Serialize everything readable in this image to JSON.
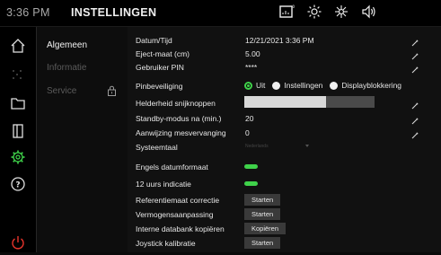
{
  "header": {
    "clock": "3:36 PM",
    "title": "INSTELLINGEN"
  },
  "status_icons": [
    "scale-icon",
    "sun-icon",
    "lamp-icon",
    "speaker-icon"
  ],
  "nav": {
    "icons": [
      "home-icon",
      "grid-icon",
      "folder-icon",
      "door-icon",
      "gear-icon",
      "help-icon",
      "power-icon"
    ]
  },
  "submenu": {
    "items": [
      {
        "label": "Algemeen"
      },
      {
        "label": "Informatie"
      },
      {
        "label": "Service"
      }
    ]
  },
  "settings": {
    "datum_tijd": {
      "label": "Datum/Tijd",
      "value": "12/21/2021 3:36 PM"
    },
    "eject_maat": {
      "label": "Eject-maat (cm)",
      "value": "5.00"
    },
    "gebruiker_pin": {
      "label": "Gebruiker PIN",
      "value": "****"
    },
    "pinbeveiliging": {
      "label": "Pinbeveiliging",
      "options": [
        "Uit",
        "Instellingen",
        "Displayblokkering"
      ],
      "selected": "Uit"
    },
    "helderheid": {
      "label": "Helderheid snijknoppen",
      "level": 0.63
    },
    "standby": {
      "label": "Standby-modus na (min.)",
      "value": "20"
    },
    "mesvervanging": {
      "label": "Aanwijzing mesvervanging",
      "value": "0"
    },
    "systeemtaal": {
      "label": "Systeemtaal",
      "value": "Nederlands"
    },
    "engels_datum": {
      "label": "Engels datumformaat",
      "on": true
    },
    "uurs_indicatie": {
      "label": "12 uurs indicatie",
      "on": true
    },
    "referentiemaat": {
      "label": "Referentiemaat correctie",
      "button": "Starten"
    },
    "vermogens": {
      "label": "Vermogensaanpassing",
      "button": "Starten"
    },
    "databank": {
      "label": "Interne databank kopiëren",
      "button": "Kopiëren"
    },
    "joystick": {
      "label": "Joystick kalibratie",
      "button": "Starten"
    }
  },
  "colors": {
    "accent": "#3fd24a",
    "background": "#111111",
    "text": "#e8e8e8"
  }
}
